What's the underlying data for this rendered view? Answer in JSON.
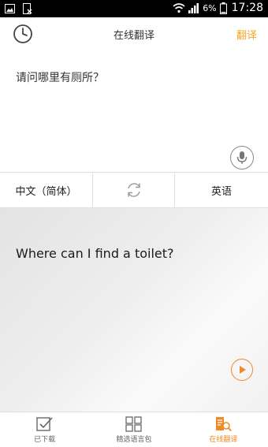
{
  "status_bar": {
    "battery_percent": "6%",
    "time": "17:28"
  },
  "header": {
    "title": "在线翻译",
    "translate_label": "翻译",
    "accent_color": "#f5a623"
  },
  "input": {
    "text": "请问哪里有厕所？"
  },
  "languages": {
    "source": "中文（简体）",
    "target": "英语"
  },
  "result": {
    "text": "Where can I find a toilet?"
  },
  "tabs": [
    {
      "label": "已下载",
      "icon": "checkbox-icon",
      "active": false
    },
    {
      "label": "精选语言包",
      "icon": "grid-icon",
      "active": false
    },
    {
      "label": "在线翻译",
      "icon": "document-search-icon",
      "active": true
    }
  ],
  "colors": {
    "accent": "#f08a24",
    "text": "#333333"
  }
}
